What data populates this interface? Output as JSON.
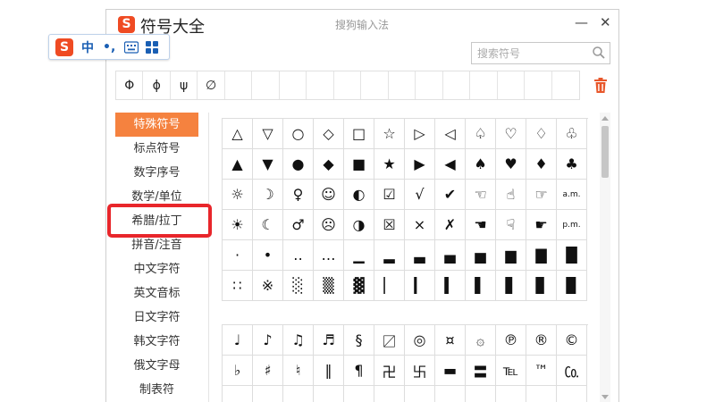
{
  "window": {
    "title": "符号大全",
    "app_name": "搜狗输入法",
    "logo": "S",
    "minimize": "—",
    "close": "✕"
  },
  "search": {
    "placeholder": "搜索符号",
    "icon": "search-icon"
  },
  "recent": [
    "Φ",
    "ϕ",
    "ψ",
    "∅",
    "",
    "",
    "",
    "",
    "",
    "",
    "",
    "",
    "",
    "",
    "",
    "",
    ""
  ],
  "categories": [
    {
      "label": "特殊符号",
      "active": true
    },
    {
      "label": "标点符号"
    },
    {
      "label": "数字序号"
    },
    {
      "label": "数学/单位"
    },
    {
      "label": "希腊/拉丁"
    },
    {
      "label": "拼音/注音"
    },
    {
      "label": "中文字符"
    },
    {
      "label": "英文音标"
    },
    {
      "label": "日文字符"
    },
    {
      "label": "韩文字符"
    },
    {
      "label": "俄文字母"
    },
    {
      "label": "制表符"
    }
  ],
  "grid1": [
    [
      "△",
      "▽",
      "○",
      "◇",
      "□",
      "☆",
      "▷",
      "◁",
      "♤",
      "♡",
      "♢",
      "♧"
    ],
    [
      "▲",
      "▼",
      "●",
      "◆",
      "■",
      "★",
      "▶",
      "◀",
      "♠",
      "♥",
      "♦",
      "♣"
    ],
    [
      "☼",
      "☽",
      "♀",
      "☺",
      "◐",
      "☑",
      "√",
      "✔",
      "☜",
      "☝",
      "☞",
      "a.m."
    ],
    [
      "☀",
      "☾",
      "♂",
      "☹",
      "◑",
      "☒",
      "×",
      "✗",
      "☚",
      "☟",
      "☛",
      "p.m."
    ],
    [
      "·",
      "•",
      "‥",
      "…",
      "▁",
      "▂",
      "▃",
      "▄",
      "▅",
      "▆",
      "▇",
      "█"
    ],
    [
      "∷",
      "※",
      "░",
      "▒",
      "▓",
      "▏",
      "▎",
      "▍",
      "▌",
      "▋",
      "▊",
      "▉"
    ]
  ],
  "grid2": [
    [
      "♩",
      "♪",
      "♫",
      "♬",
      "§",
      "〼",
      "◎",
      "¤",
      "۞",
      "℗",
      "®",
      "©"
    ],
    [
      "♭",
      "♯",
      "♮",
      "‖",
      "¶",
      "卍",
      "卐",
      "▬",
      "〓",
      "℡",
      "™",
      "㏇"
    ],
    [
      "",
      "",
      "",
      "",
      "",
      "",
      "",
      "",
      "",
      "",
      "",
      ""
    ]
  ],
  "ime": {
    "logo": "S",
    "lang": "中",
    "punct": "•,",
    "keyboard": "keyboard-icon",
    "toolbox": "grid-icon"
  },
  "colors": {
    "active_category": "#f5823f",
    "brand": "#ef4b23",
    "highlight": "#e8262b",
    "ime_text": "#1a5fb4"
  }
}
